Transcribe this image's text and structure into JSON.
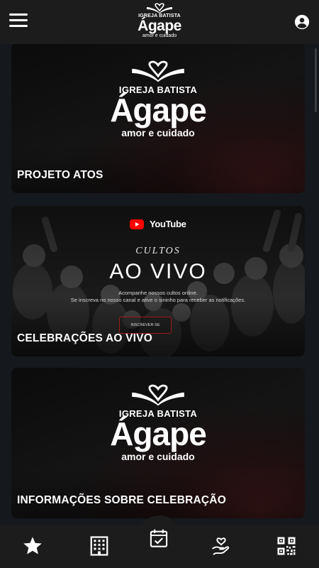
{
  "header": {
    "logo": {
      "top_text": "IGREJA BATISTA",
      "name": "Ágape",
      "tagline": "amor e cuidado"
    },
    "menu_icon": "hamburger-menu-icon",
    "account_icon": "account-circle-icon"
  },
  "cards": [
    {
      "label": "PROJETO ATOS",
      "logo": {
        "top_text": "IGREJA BATISTA",
        "name": "Ágape",
        "tagline": "amor e cuidado"
      }
    },
    {
      "label": "CELEBRAÇÕES AO VIVO",
      "youtube_text": "YouTube",
      "cultos": "CULTOS",
      "title": "AO VIVO",
      "desc_line1": "Acompanhe nossos cultos online.",
      "desc_line2": "Se inscreva no nosso canal e ative o sininho para receber as notificações.",
      "subscribe_button": "INSCREVER-SE"
    },
    {
      "label": "INFORMAÇÕES SOBRE CELEBRAÇÃO",
      "logo": {
        "top_text": "IGREJA BATISTA",
        "name": "Ágape",
        "tagline": "amor e cuidado"
      }
    }
  ],
  "bottom_nav": [
    {
      "icon": "star-icon"
    },
    {
      "icon": "building-icon"
    },
    {
      "icon": "calendar-check-icon"
    },
    {
      "icon": "heart-hand-icon"
    },
    {
      "icon": "qr-code-icon"
    }
  ],
  "colors": {
    "header_bg": "#1c1c1c",
    "page_bg": "#15181d",
    "accent_red": "#9b1b1b",
    "youtube_red": "#ff0000"
  }
}
